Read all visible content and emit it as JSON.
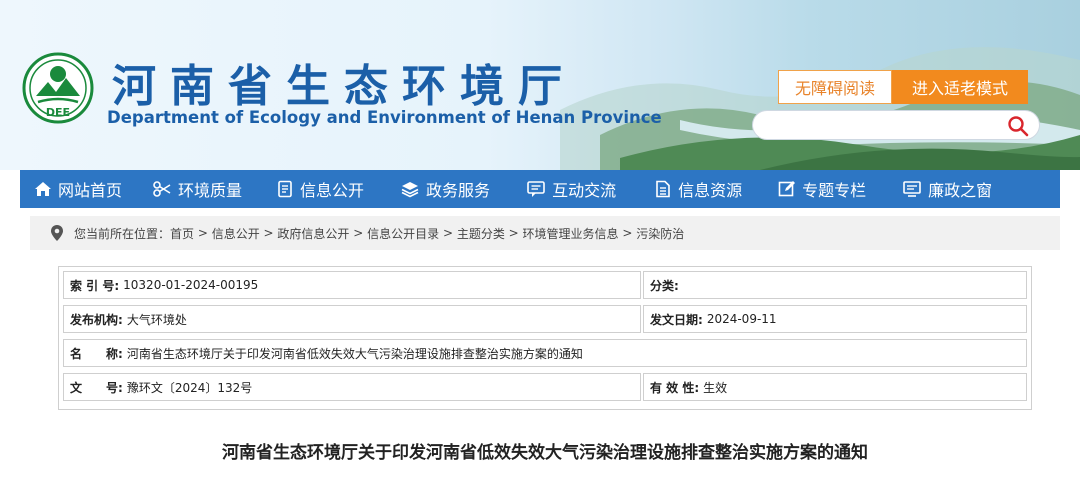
{
  "header": {
    "title_cn": "河南省生态环境厅",
    "title_en": "Department of Ecology and Environment of Henan Province",
    "logo_text": "DEE",
    "accessibility_btn": "无障碍阅读",
    "elder_mode_btn": "进入适老模式",
    "search_placeholder": ""
  },
  "nav": {
    "items": [
      {
        "label": "网站首页",
        "icon": "home-icon"
      },
      {
        "label": "环境质量",
        "icon": "scissors-icon"
      },
      {
        "label": "信息公开",
        "icon": "document-icon"
      },
      {
        "label": "政务服务",
        "icon": "layers-icon"
      },
      {
        "label": "互动交流",
        "icon": "chat-icon"
      },
      {
        "label": "信息资源",
        "icon": "file-icon"
      },
      {
        "label": "专题专栏",
        "icon": "edit-icon"
      },
      {
        "label": "廉政之窗",
        "icon": "window-icon"
      }
    ]
  },
  "breadcrumb": {
    "prefix": "您当前所在位置：",
    "items": [
      "首页",
      "信息公开",
      "政府信息公开",
      "信息公开目录",
      "主题分类",
      "环境管理业务信息",
      "污染防治"
    ],
    "separator": " > "
  },
  "info_table": {
    "index_label": "索 引 号:",
    "index_value": "10320-01-2024-00195",
    "category_label": "分类:",
    "category_value": "",
    "issuer_label": "发布机构:",
    "issuer_value": "大气环境处",
    "date_label": "发文日期:",
    "date_value": "2024-09-11",
    "name_label": "名　　称:",
    "name_value": "河南省生态环境厅关于印发河南省低效失效大气污染治理设施排查整治实施方案的通知",
    "docno_label": "文　　号:",
    "docno_value": "豫环文〔2024〕132号",
    "validity_label": "有 效 性:",
    "validity_value": "生效"
  },
  "document": {
    "title": "河南省生态环境厅关于印发河南省低效失效大气污染治理设施排查整治实施方案的通知"
  },
  "colors": {
    "brand_blue": "#1b5fa8",
    "nav_blue": "#2d76c4",
    "accent_orange": "#f28a1e",
    "logo_green": "#1a8a3c"
  }
}
